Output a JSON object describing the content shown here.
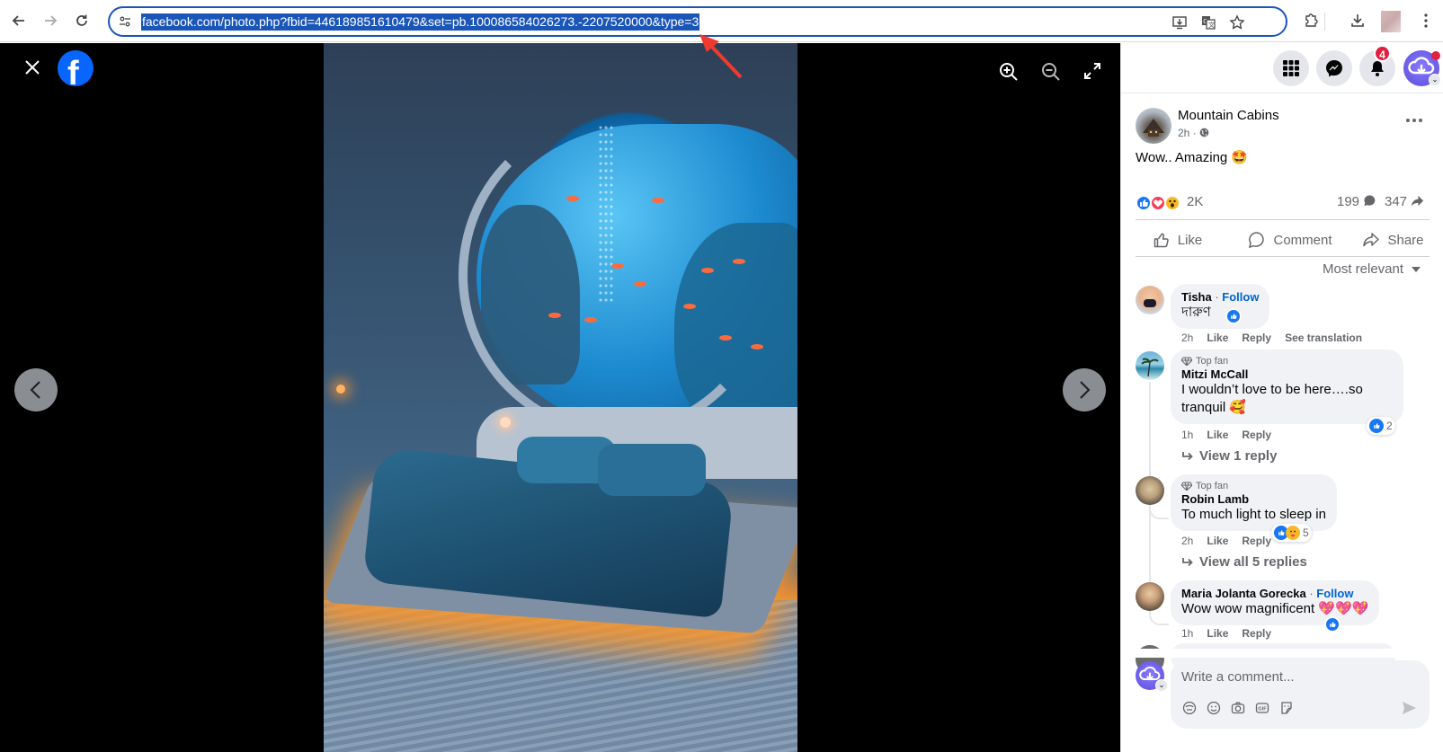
{
  "browser": {
    "url": "facebook.com/photo.php?fbid=446189851610479&set=pb.100086584026273.-2207520000&type=3",
    "icons": {
      "back": "back-arrow-icon",
      "forward": "forward-arrow-icon",
      "reload": "reload-icon",
      "site_info": "site-info-icon",
      "install": "install-app-icon",
      "translate": "translate-icon",
      "bookmark": "star-icon",
      "extensions": "puzzle-icon",
      "downloads": "download-icon",
      "menu": "kebab-menu-icon"
    }
  },
  "viewer": {
    "close_icon": "close-icon",
    "logo": "f",
    "tools": [
      "zoom-in-icon",
      "zoom-out-icon",
      "fullscreen-icon"
    ],
    "photo_alt": "Futuristic underwater cave bedroom with a round aquarium window, blue velvet bed, and glowing orange under-bed lighting"
  },
  "topbar": {
    "notification_count": "4"
  },
  "post": {
    "author": "Mountain Cabins",
    "time": "2h",
    "privacy": "·",
    "text": "Wow.. Amazing 🤩",
    "reaction_count": "2K",
    "comment_count": "199",
    "share_count": "347",
    "actions": {
      "like": "Like",
      "comment": "Comment",
      "share": "Share"
    },
    "sort": "Most relevant"
  },
  "comments": [
    {
      "name": "Tisha",
      "follow": "Follow",
      "sep": " · ",
      "text": "দারুণ",
      "time": "2h",
      "like": "Like",
      "reply": "Reply",
      "translate": "See translation"
    },
    {
      "badge": "Top fan",
      "name": "Mitzi McCall",
      "text": "I wouldn’t love to be here….so tranquil 🥰",
      "time": "1h",
      "like": "Like",
      "reply": "Reply",
      "reaction_count": "2",
      "view_replies": "View 1 reply"
    },
    {
      "badge": "Top fan",
      "name": "Robin Lamb",
      "text": "To much light to sleep in",
      "time": "2h",
      "like": "Like",
      "reply": "Reply",
      "reaction_count": "5",
      "view_replies": "View all 5 replies"
    },
    {
      "name": "Maria Jolanta Gorecka",
      "follow": "Follow",
      "sep": " · ",
      "text": "Wow wow magnificent 💖💖💖",
      "time": "1h",
      "like": "Like",
      "reply": "Reply"
    }
  ],
  "composer": {
    "placeholder": "Write a comment..."
  },
  "colors": {
    "fb_blue": "#0866ff",
    "link_blue": "#0064d1",
    "badge_red": "#e41e3f",
    "url_highlight": "#1a56b8"
  }
}
